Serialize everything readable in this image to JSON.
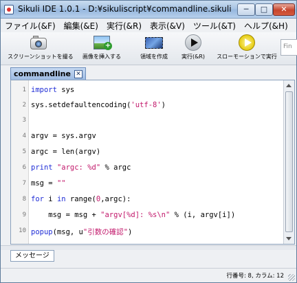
{
  "window": {
    "title": "Sikuli IDE 1.0.1 - D:¥sikuliscript¥commandline.sikuli",
    "minimize_glyph": "─",
    "maximize_glyph": "□",
    "close_glyph": "✕"
  },
  "menu": [
    "ファイル(&F)",
    "編集(&E)",
    "実行(&R)",
    "表示(&V)",
    "ツール(&T)",
    "ヘルプ(&H)"
  ],
  "toolbar": {
    "capture_label": "スクリーンショットを撮る",
    "insert_image_label": "画像を挿入する",
    "region_label": "領域を作成",
    "run_label": "実行(&R)",
    "slow_run_label": "スローモーションで実行",
    "find_placeholder": "Fin"
  },
  "tab": {
    "label": "commandline",
    "close_glyph": "✕"
  },
  "editor": {
    "line_numbers": [
      "1",
      "2",
      "3",
      "4",
      "5",
      "6",
      "7",
      "8",
      "9",
      "10"
    ],
    "lines": [
      "import sys",
      "sys.setdefaultencoding('utf-8')",
      "",
      "argv = sys.argv",
      "argc = len(argv)",
      "print \"argc: %d\" % argc",
      "msg = \"\"",
      "for i in range(0,argc):",
      "    msg = msg + \"argv[%d]: %s\\n\" % (i, argv[i])",
      "popup(msg, u\"引数の確認\")"
    ]
  },
  "message_pane": {
    "tab_label": "メッセージ"
  },
  "status": {
    "text": "行番号: 8, カラム: 12"
  },
  "colors": {
    "keyword": "#1f2dd6",
    "string": "#c2186b"
  }
}
